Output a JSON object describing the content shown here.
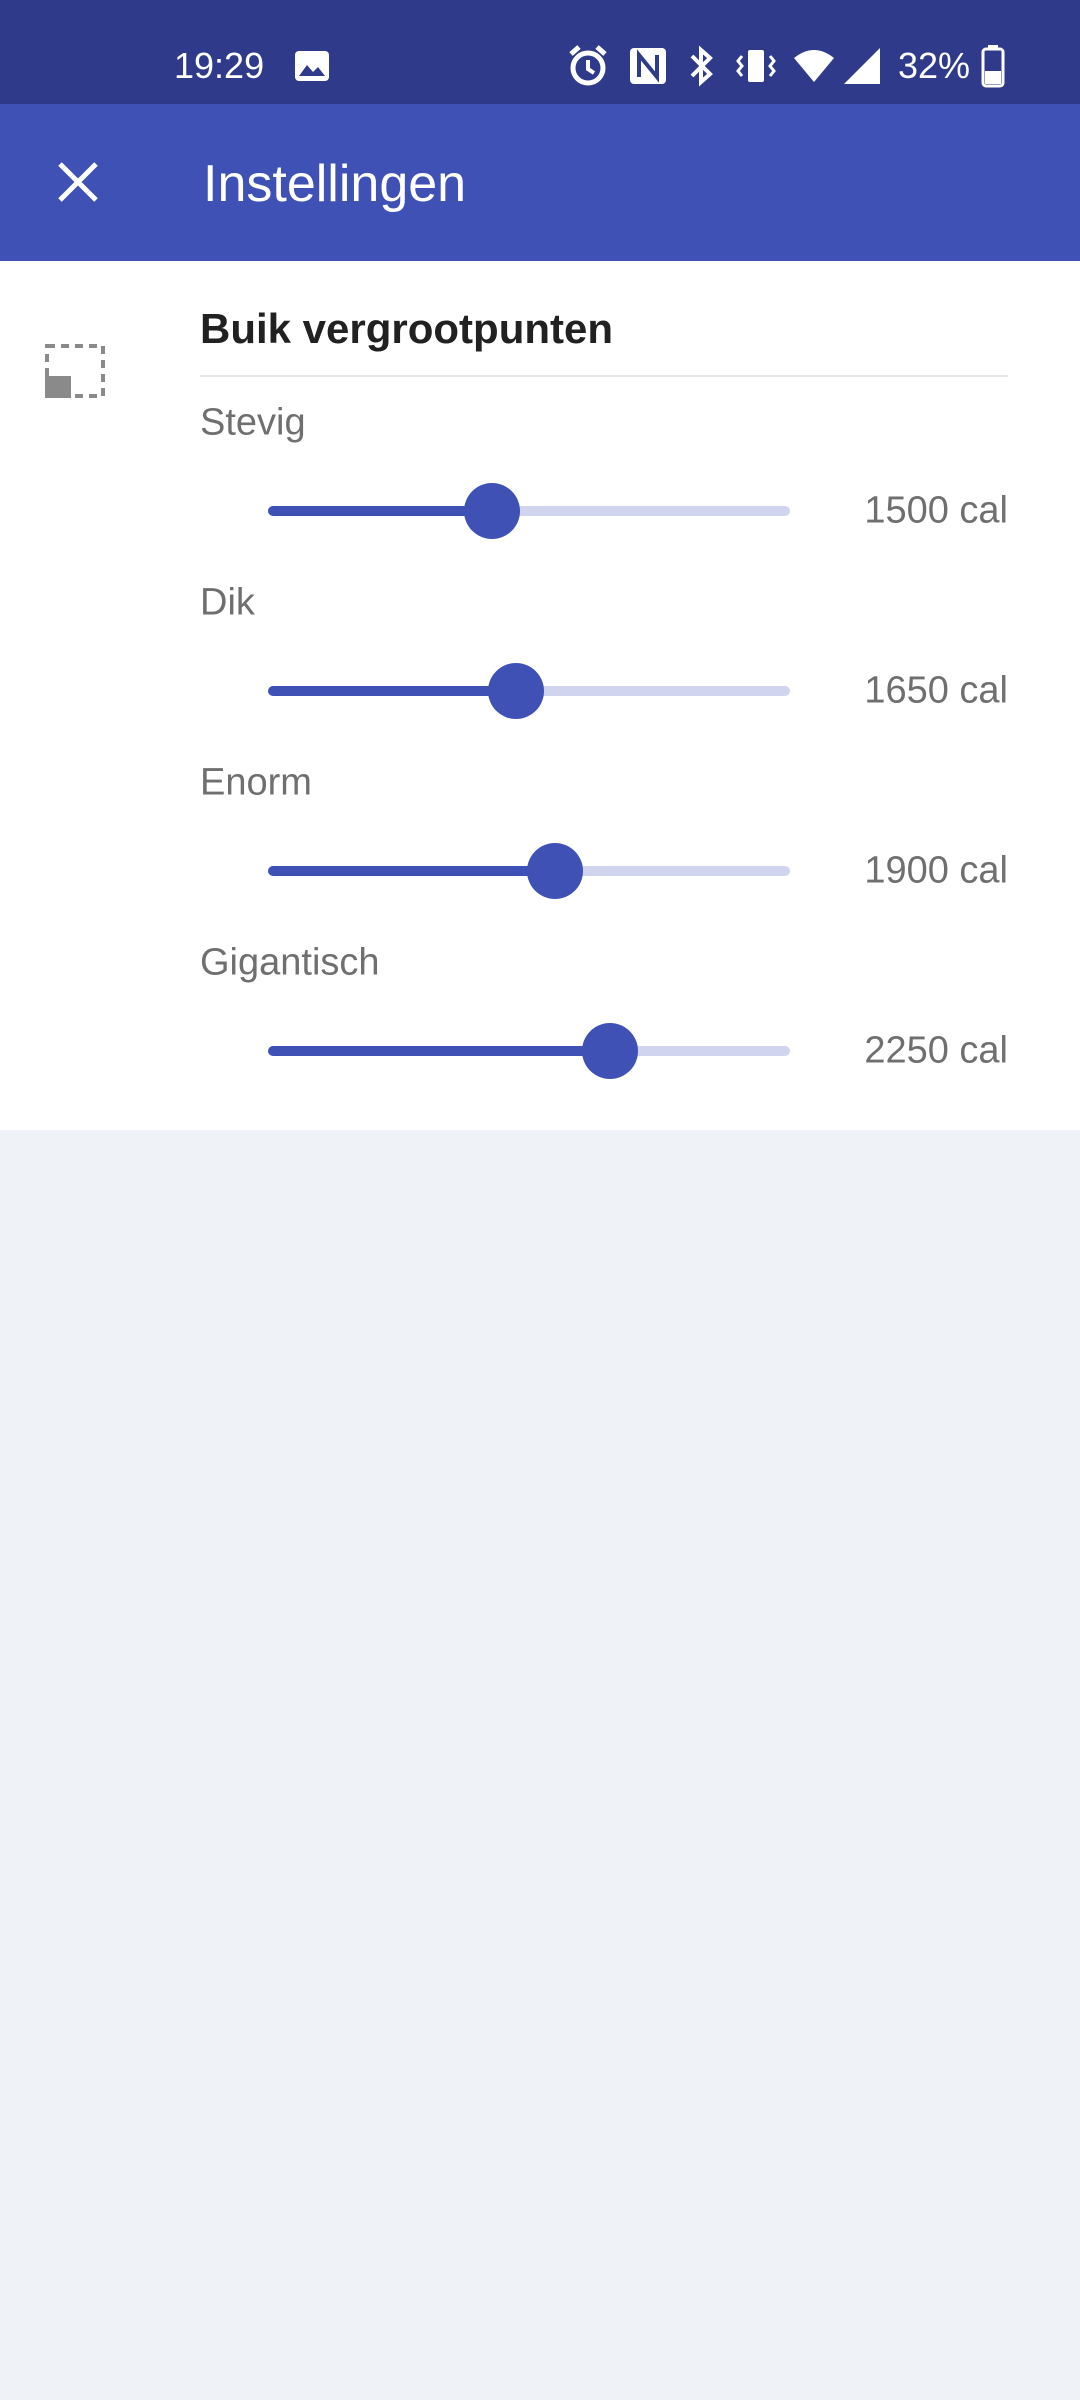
{
  "status_bar": {
    "time": "19:29",
    "battery": "32%",
    "icons": [
      "photo-icon",
      "alarm-icon",
      "nfc-icon",
      "bluetooth-icon",
      "vibrate-icon",
      "wifi-icon",
      "signal-icon",
      "battery-icon"
    ]
  },
  "app_bar": {
    "title": "Instellingen",
    "close_icon": "close-icon"
  },
  "section": {
    "icon": "dashed-selection-icon",
    "title": "Buik vergrootpunten"
  },
  "preferences": [
    {
      "label": "Stevig",
      "value": "1500 cal",
      "fraction": 0.43
    },
    {
      "label": "Dik",
      "value": "1650 cal",
      "fraction": 0.475
    },
    {
      "label": "Enorm",
      "value": "1900 cal",
      "fraction": 0.55
    },
    {
      "label": "Gigantisch",
      "value": "2250 cal",
      "fraction": 0.655
    }
  ],
  "colors": {
    "status_bar": "#2f3b8a",
    "app_bar": "#3f51b5",
    "accent": "#3f51b5",
    "track": "#d0d4ee",
    "background": "#eff3f7"
  }
}
